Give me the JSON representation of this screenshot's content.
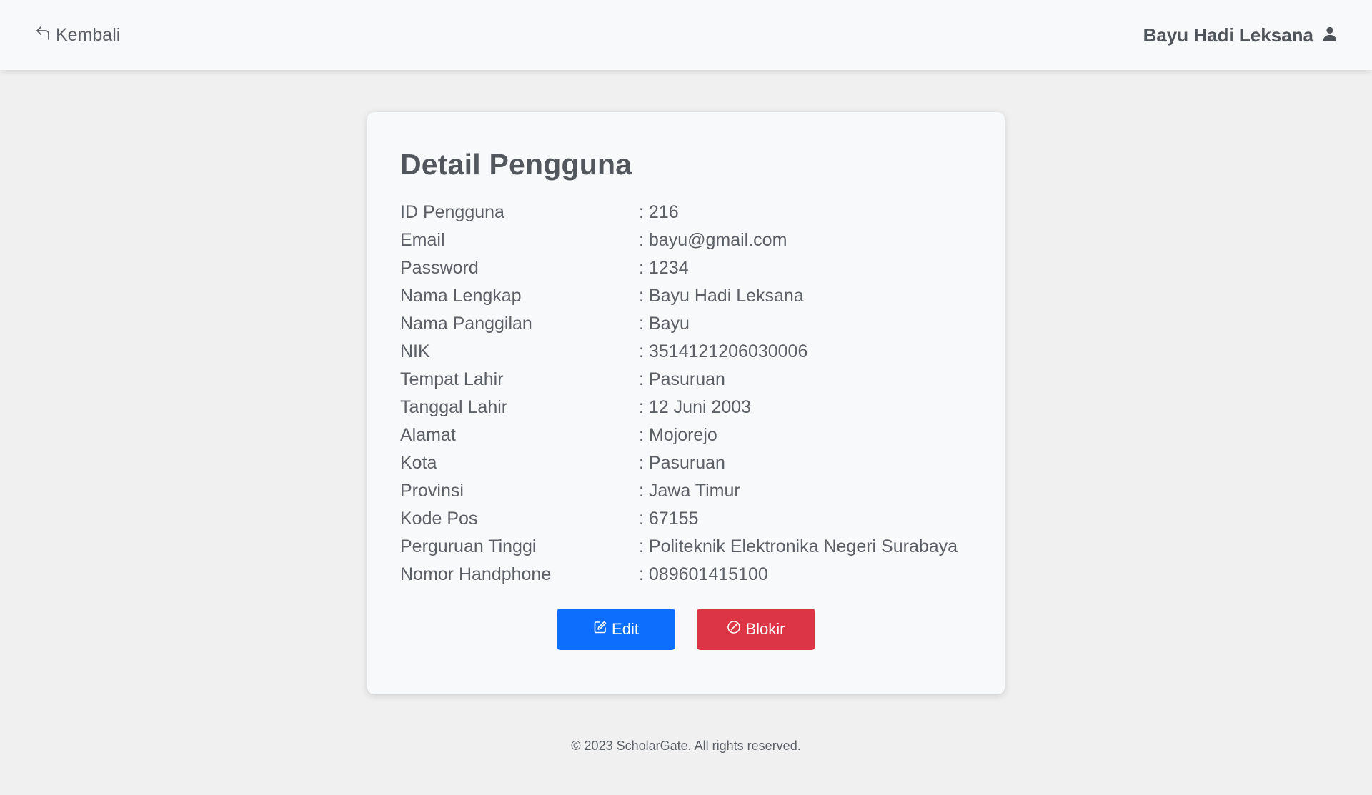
{
  "navbar": {
    "back_label": "Kembali",
    "user_name": "Bayu Hadi Leksana"
  },
  "card": {
    "title": "Detail Pengguna",
    "details": [
      {
        "label": "ID Pengguna",
        "value": "216"
      },
      {
        "label": "Email",
        "value": "bayu@gmail.com"
      },
      {
        "label": "Password",
        "value": "1234"
      },
      {
        "label": "Nama Lengkap",
        "value": "Bayu Hadi Leksana"
      },
      {
        "label": "Nama Panggilan",
        "value": "Bayu"
      },
      {
        "label": "NIK",
        "value": "3514121206030006"
      },
      {
        "label": "Tempat Lahir",
        "value": "Pasuruan"
      },
      {
        "label": "Tanggal Lahir",
        "value": "12 Juni 2003"
      },
      {
        "label": "Alamat",
        "value": "Mojorejo"
      },
      {
        "label": "Kota",
        "value": "Pasuruan"
      },
      {
        "label": "Provinsi",
        "value": "Jawa Timur"
      },
      {
        "label": "Kode Pos",
        "value": "67155"
      },
      {
        "label": "Perguruan Tinggi",
        "value": "Politeknik Elektronika Negeri Surabaya"
      },
      {
        "label": "Nomor Handphone",
        "value": "089601415100"
      }
    ],
    "edit_label": "Edit",
    "block_label": "Blokir"
  },
  "footer": {
    "text": "© 2023 ScholarGate. All rights reserved."
  },
  "colors": {
    "primary": "#0d6efd",
    "danger": "#dc3545",
    "background": "#f0f0f0",
    "card": "#f8f9fb"
  },
  "icons": {
    "back": "arrow-return-left-icon",
    "user": "person-icon",
    "edit": "pencil-square-icon",
    "block": "slash-circle-icon"
  }
}
